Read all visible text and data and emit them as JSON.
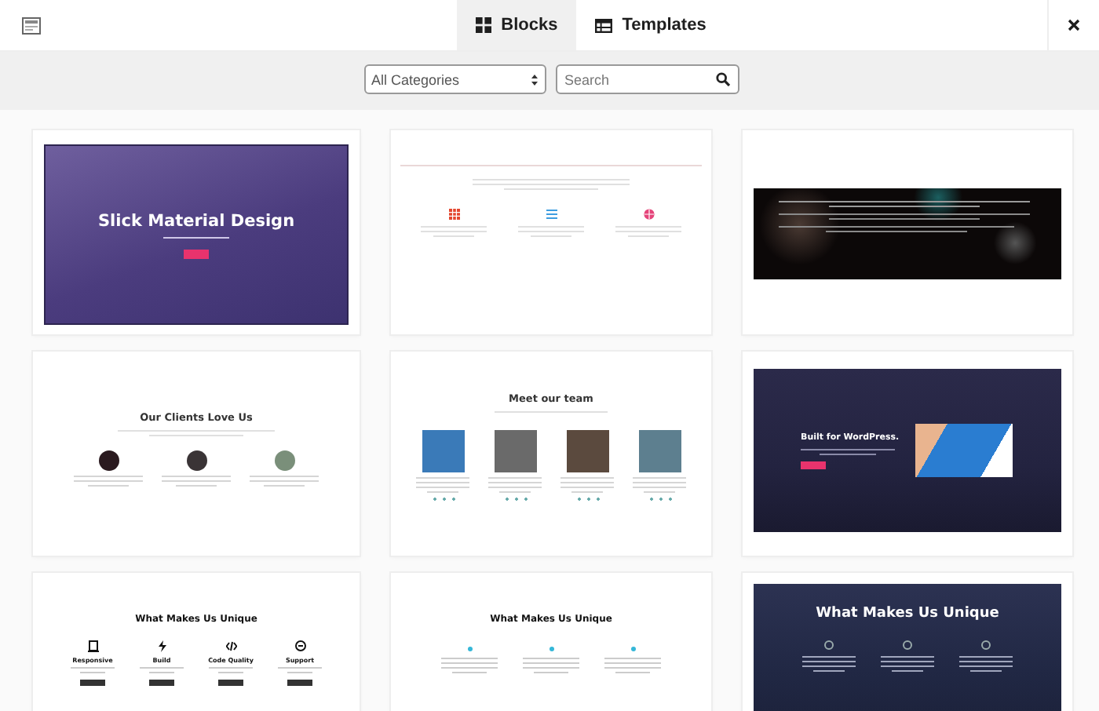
{
  "tabs": [
    {
      "label": "Blocks",
      "selected": true
    },
    {
      "label": "Templates",
      "selected": false
    }
  ],
  "filters": {
    "category": "All Categories",
    "search": {
      "placeholder": "Search"
    }
  },
  "cards": [
    {
      "kind": "hero",
      "heading": "Slick Material Design"
    },
    {
      "kind": "features"
    },
    {
      "kind": "dark-text"
    },
    {
      "kind": "testimonials",
      "heading": "Our Clients Love Us"
    },
    {
      "kind": "team",
      "heading": "Meet our team"
    },
    {
      "kind": "video-hero",
      "heading": "Built for WordPress."
    },
    {
      "kind": "unique-icons",
      "heading": "What Makes Us Unique",
      "features": [
        "Responsive",
        "Build",
        "Code Quality",
        "Support"
      ]
    },
    {
      "kind": "unique-light",
      "heading": "What Makes Us Unique"
    },
    {
      "kind": "unique-dark",
      "heading": "What Makes Us Unique"
    }
  ]
}
